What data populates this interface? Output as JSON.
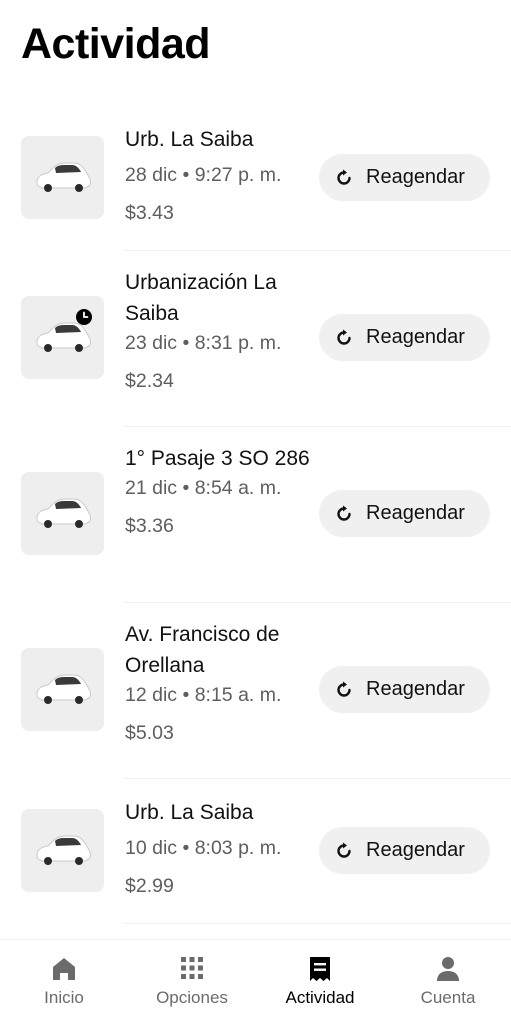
{
  "header": {
    "title": "Actividad"
  },
  "trips": [
    {
      "destination": "Urb. La Saiba",
      "datetime": "28 dic • 9:27 p. m.",
      "price": "$3.43",
      "action_label": "Reagendar",
      "scheduled": false
    },
    {
      "destination": "Urbanización La Saiba",
      "datetime": "23 dic • 8:31 p. m.",
      "price": "$2.34",
      "action_label": "Reagendar",
      "scheduled": true
    },
    {
      "destination": "1° Pasaje 3 SO 286",
      "datetime": "21 dic • 8:54 a. m.",
      "price": "$3.36",
      "action_label": "Reagendar",
      "scheduled": false
    },
    {
      "destination": "Av. Francisco de Orellana",
      "datetime": "12 dic • 8:15 a. m.",
      "price": "$5.03",
      "action_label": "Reagendar",
      "scheduled": false
    },
    {
      "destination": "Urb. La Saiba",
      "datetime": "10 dic • 8:03 p. m.",
      "price": "$2.99",
      "action_label": "Reagendar",
      "scheduled": false
    }
  ],
  "bottom_nav": {
    "items": [
      {
        "label": "Inicio",
        "icon": "home-icon",
        "active": false
      },
      {
        "label": "Opciones",
        "icon": "grid-icon",
        "active": false
      },
      {
        "label": "Actividad",
        "icon": "receipt-icon",
        "active": true
      },
      {
        "label": "Cuenta",
        "icon": "person-icon",
        "active": false
      }
    ]
  },
  "colors": {
    "text_primary": "#000000",
    "text_secondary": "#5e5e5e",
    "button_bg": "#f0f0f0",
    "thumb_bg": "#eeeeee",
    "nav_inactive": "#6b6b6b"
  }
}
